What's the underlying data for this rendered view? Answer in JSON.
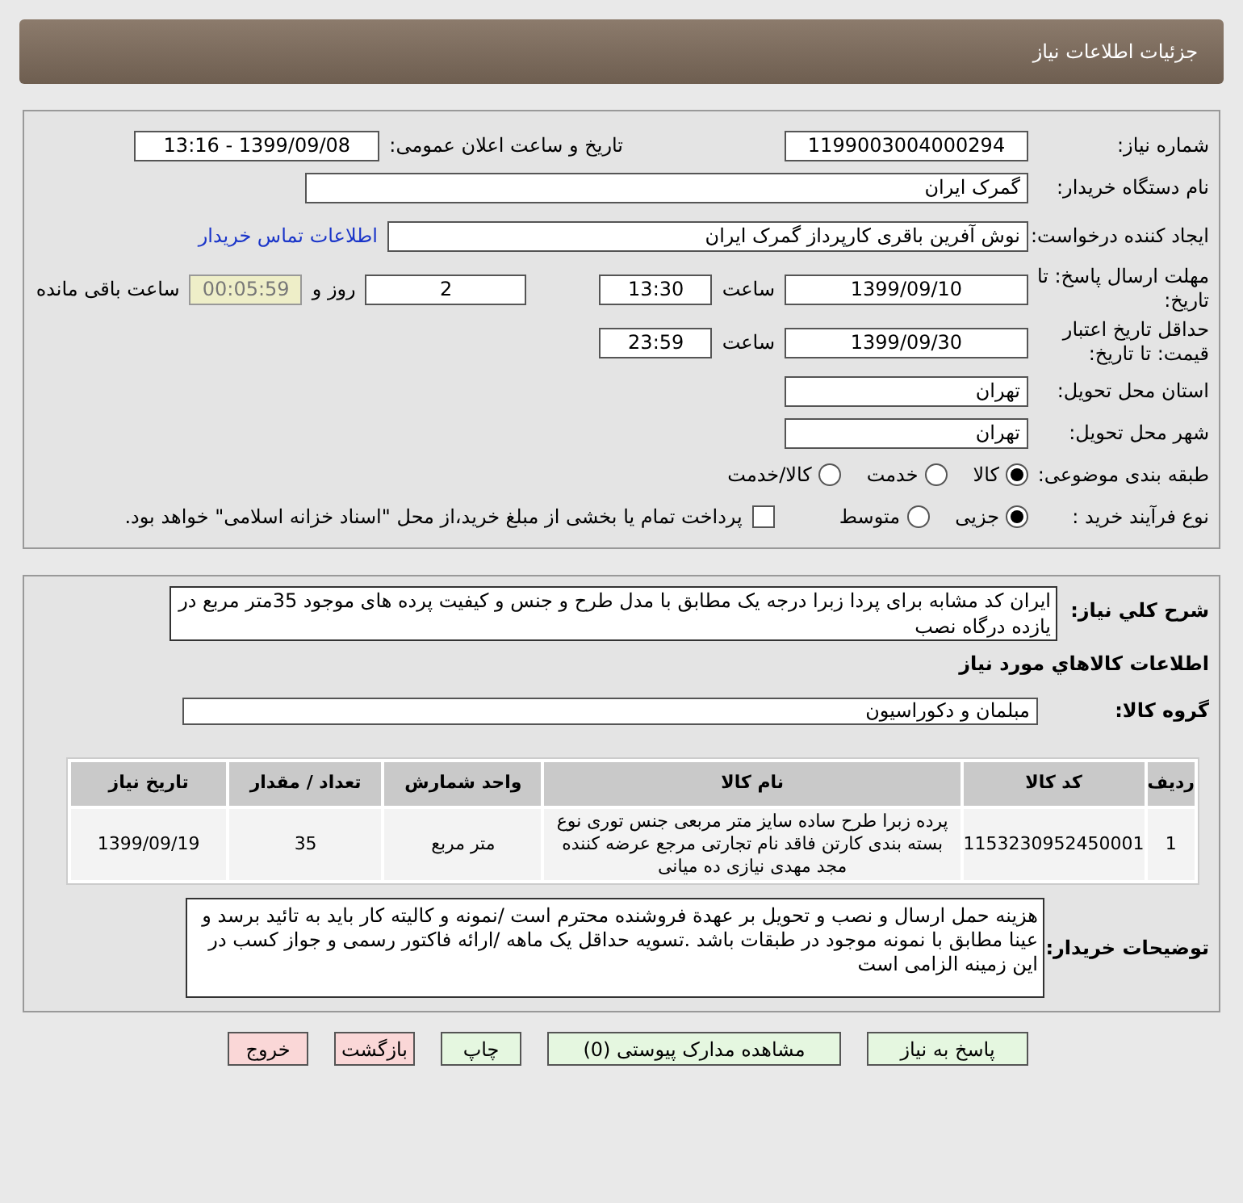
{
  "header": {
    "title": "جزئیات اطلاعات نیاز"
  },
  "need_number": {
    "label": "شماره نیاز:",
    "value": "1199003004000294"
  },
  "announce": {
    "label": "تاریخ و ساعت اعلان عمومی:",
    "value": "1399/09/08 - 13:16"
  },
  "buyer_org": {
    "label": "نام دستگاه خریدار:",
    "value": "گمرک ایران"
  },
  "requester": {
    "label": "ایجاد کننده درخواست:",
    "value": "نوش آفرین باقری کارپرداز گمرک ایران",
    "link": "اطلاعات تماس خریدار"
  },
  "deadline": {
    "label": "مهلت ارسال پاسخ: تا تاریخ:",
    "date": "1399/09/10",
    "time_label": "ساعت",
    "time": "13:30",
    "days": "2",
    "days_label": "روز و",
    "remaining": "00:05:59",
    "remaining_label": "ساعت باقی مانده"
  },
  "validity": {
    "label": "حداقل تاریخ اعتبار قیمت: تا تاریخ:",
    "date": "1399/09/30",
    "time_label": "ساعت",
    "time": "23:59"
  },
  "province": {
    "label": "استان محل تحویل:",
    "value": "تهران"
  },
  "city": {
    "label": "شهر محل تحویل:",
    "value": "تهران"
  },
  "category": {
    "label": "طبقه بندی موضوعی:",
    "options": [
      {
        "label": "کالا",
        "selected": true
      },
      {
        "label": "خدمت",
        "selected": false
      },
      {
        "label": "کالا/خدمت",
        "selected": false
      }
    ]
  },
  "process": {
    "label": "نوع فرآیند خرید :",
    "options": [
      {
        "label": "جزیی",
        "selected": true
      },
      {
        "label": "متوسط",
        "selected": false
      }
    ],
    "treasury": {
      "label": "پرداخت تمام یا بخشی از مبلغ خرید،از محل \"اسناد خزانه اسلامی\" خواهد بود.",
      "checked": false
    }
  },
  "description": {
    "label": "شرح کلي نیاز:",
    "value": "ایران کد مشابه برای پردا زبرا درجه یک مطابق با مدل طرح و جنس و کیفیت پرده های موجود 35متر مربع در یازده درگاه نصب"
  },
  "goods_title": "اطلاعات کالاهاي مورد نیاز",
  "goods_group": {
    "label": "گروه کالا:",
    "value": "مبلمان و دکوراسیون"
  },
  "table": {
    "columns": [
      "ردیف",
      "کد کالا",
      "نام کالا",
      "واحد شمارش",
      "تعداد / مقدار",
      "تاریخ نیاز"
    ],
    "rows": [
      [
        "1",
        "1153230952450001",
        "پرده زبرا طرح ساده سایز متر مربعی جنس توری نوع بسته بندی کارتن فاقد نام تجارتی مرجع عرضه کننده مجد مهدی نیازی ده میانی",
        "متر مربع",
        "35",
        "1399/09/19"
      ]
    ]
  },
  "buyer_notes": {
    "label": "توضیحات خریدار:",
    "value": "هزینه حمل ارسال و نصب و تحویل بر عهدة فروشنده محترم است /نمونه و کالیته کار باید به تائید برسد و عینا مطابق با نمونه موجود در طبقات باشد .تسویه حداقل یک ماهه /ارائه فاکتور رسمی و جواز کسب در این زمینه الزامی است"
  },
  "buttons": [
    {
      "label": "پاسخ به نیاز",
      "kind": "primary"
    },
    {
      "label": "مشاهده مدارک پیوستی (0)",
      "kind": "primary"
    },
    {
      "label": "چاپ",
      "kind": "primary"
    },
    {
      "label": "بازگشت",
      "kind": "danger"
    },
    {
      "label": "خروج",
      "kind": "danger"
    }
  ]
}
